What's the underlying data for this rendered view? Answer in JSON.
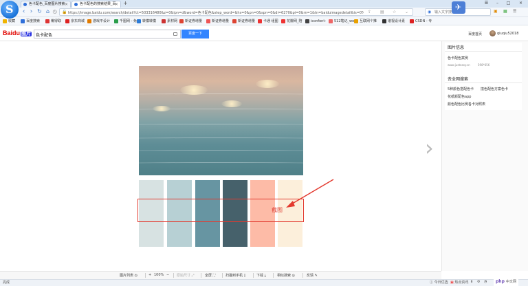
{
  "tabs": [
    {
      "label": "色卡配色_百度图片搜索",
      "active": false
    },
    {
      "label": "色卡配色的搜索结果_百",
      "active": true
    }
  ],
  "address": {
    "url": "https://image.baidu.com/search/detail?ct=503316480&z=0&ipn=d&word=色卡配色&step_word=&hs=0&pn=0&spn=0&di=6270&pi=0&rn=1&tn=baiduimagedetail&is=0%",
    "search_placeholder": "输入文字搜索"
  },
  "bookmarks": [
    {
      "label": "收藏",
      "color": "#f0b400"
    },
    {
      "label": "百度搜索",
      "color": "#2f6fd9"
    },
    {
      "label": "懒得取",
      "color": "#d33"
    },
    {
      "label": "京东商城",
      "color": "#d22"
    },
    {
      "label": "游戏平设计",
      "color": "#e27b00"
    },
    {
      "label": "千图网 - 免",
      "color": "#2a9d4b"
    },
    {
      "label": "转模转模",
      "color": "#2a7bd9"
    },
    {
      "label": "素材网",
      "color": "#c33"
    },
    {
      "label": "新证券增量",
      "color": "#d43"
    },
    {
      "label": "新证券增量",
      "color": "#e55"
    },
    {
      "label": "新证券增量",
      "color": "#d43"
    },
    {
      "label": "卡通 组图",
      "color": "#e33"
    },
    {
      "label": "花瓣网_陪",
      "color": "#e33"
    },
    {
      "label": "iconfont-",
      "color": "#444"
    },
    {
      "label": "512笔记_we",
      "color": "#e66"
    },
    {
      "label": "互联网个推",
      "color": "#e8a000"
    },
    {
      "label": "谱视设计素",
      "color": "#333"
    },
    {
      "label": "CSDN - 专",
      "color": "#d22"
    }
  ],
  "header": {
    "logo_bai": "Bai",
    "logo_du": "du",
    "logo_tu": "图片",
    "query": "色卡配色",
    "search_button": "百度一下",
    "home_link": "百度首页",
    "username": "qiuqiu52018"
  },
  "swatches": [
    "#d7e2e2",
    "#b7d0d4",
    "#6795a2",
    "#46616b",
    "#fdbba7",
    "#fcefdb"
  ],
  "annotation": {
    "label": "截图",
    "color": "#e33a2f"
  },
  "sidepanel": {
    "info_title": "图片信息",
    "image_title": "色卡配色案例",
    "source": "www.justeasy.cn",
    "size": "598*656",
    "related_title": "去全网搜索",
    "related": [
      "5种颜色搭配色卡",
      "撞色配色方案色卡",
      "花纸颜配色app",
      "颜色配色比例各卡对照表"
    ]
  },
  "toolbar": {
    "items": [
      "图片列表",
      "100%",
      "原始尺寸",
      "全屏",
      "扫描到手机",
      "下载",
      "相似搜索",
      "反馈"
    ]
  },
  "status": {
    "left": "完成",
    "items": [
      "今日优选",
      "热点资讯"
    ],
    "zoom": "100%",
    "badge_php": "php",
    "badge_site": "中文网"
  }
}
